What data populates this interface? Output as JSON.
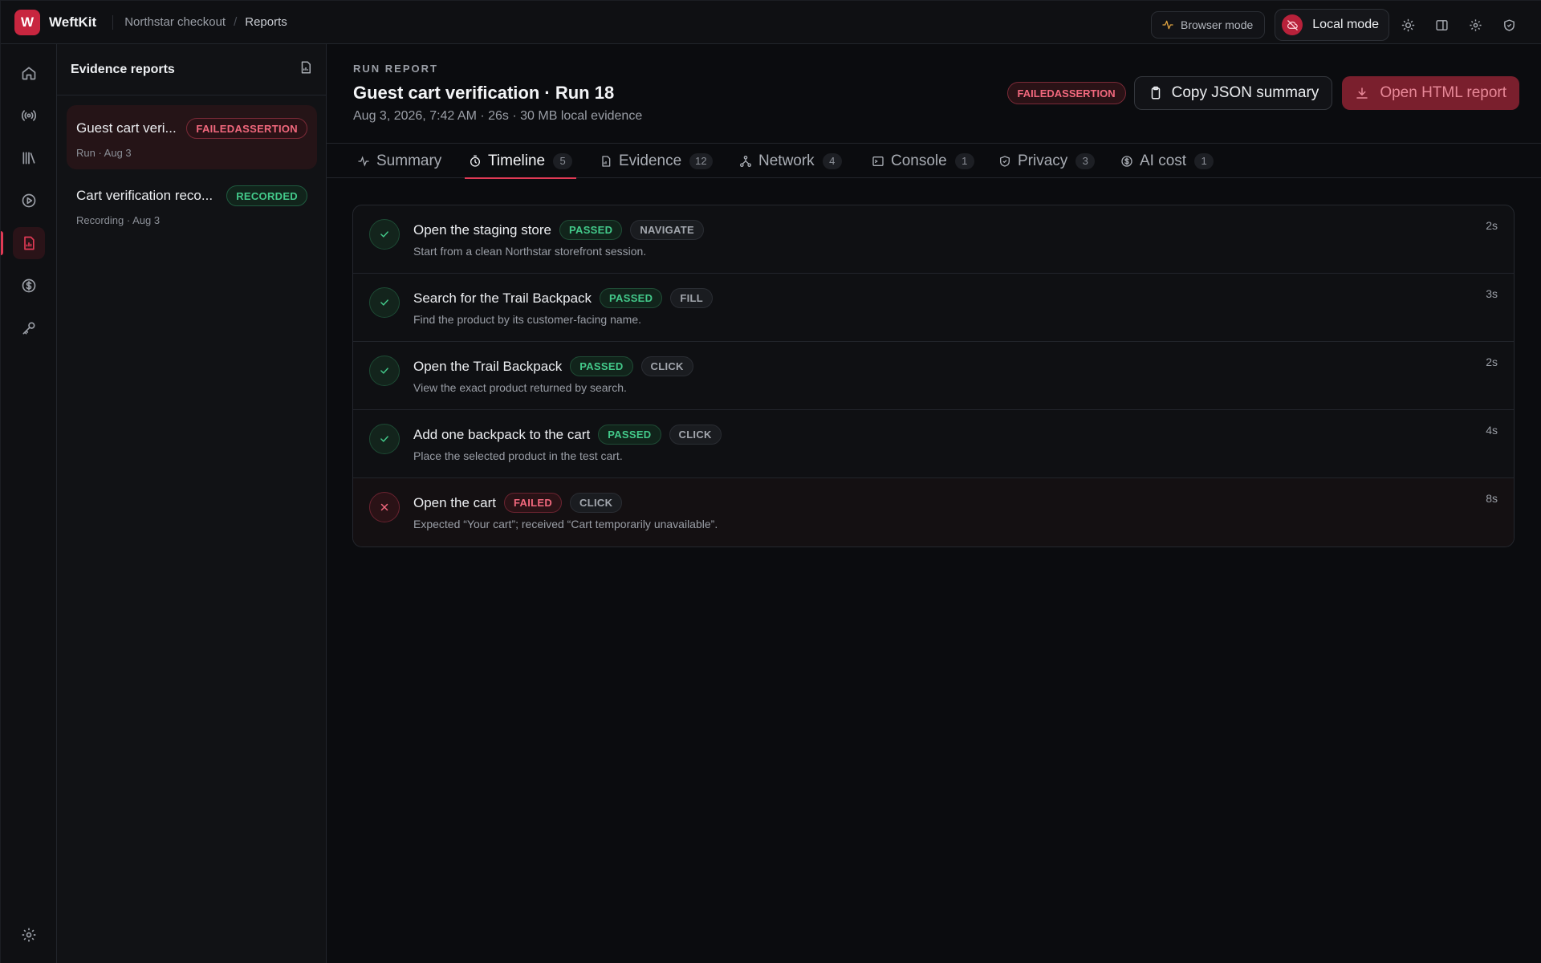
{
  "app": {
    "logo_letter": "W",
    "name": "WeftKit"
  },
  "breadcrumb": {
    "project": "Northstar checkout",
    "separator": "/",
    "current": "Reports"
  },
  "topbar": {
    "browser_mode_label": "Browser mode",
    "local_mode_label": "Local mode",
    "icons": [
      "sun-icon",
      "panel-icon",
      "gear-icon",
      "shield-icon"
    ]
  },
  "rail": {
    "items": [
      "home-icon",
      "broadcast-icon",
      "library-icon",
      "play-icon",
      "report-icon",
      "dollar-icon",
      "key-icon"
    ],
    "active": "report-icon",
    "bottom": "gear-icon"
  },
  "panel": {
    "title": "Evidence reports",
    "reports": [
      {
        "title": "Guest cart veri...",
        "badge": "FAILEDASSERTION",
        "subtitle": "Run · Aug 3",
        "active": true
      },
      {
        "title": "Cart verification reco...",
        "badge": "RECORDED",
        "subtitle": "Recording · Aug 3",
        "active": false
      }
    ]
  },
  "report": {
    "kicker": "RUN REPORT",
    "title": "Guest cart verification · Run 18",
    "meta": "Aug 3, 2026, 7:42 AM · 26s · 30 MB local evidence",
    "status_badge": "FAILEDASSERTION",
    "copy_button": "Copy JSON summary",
    "open_button": "Open HTML report"
  },
  "tabs": [
    {
      "label": "Summary",
      "count": "",
      "icon": "activity-icon"
    },
    {
      "label": "Timeline",
      "count": "5",
      "icon": "timer-icon",
      "active": true
    },
    {
      "label": "Evidence",
      "count": "12",
      "icon": "file-icon"
    },
    {
      "label": "Network",
      "count": "4",
      "icon": "network-icon"
    },
    {
      "label": "Console",
      "count": "1",
      "icon": "console-icon"
    },
    {
      "label": "Privacy",
      "count": "3",
      "icon": "shield-icon"
    },
    {
      "label": "AI cost",
      "count": "1",
      "icon": "dollar-icon"
    }
  ],
  "steps": [
    {
      "title": "Open the staging store",
      "status": "PASSED",
      "action": "NAVIGATE",
      "desc": "Start from a clean Northstar storefront session.",
      "duration": "2s"
    },
    {
      "title": "Search for the Trail Backpack",
      "status": "PASSED",
      "action": "FILL",
      "desc": "Find the product by its customer-facing name.",
      "duration": "3s"
    },
    {
      "title": "Open the Trail Backpack",
      "status": "PASSED",
      "action": "CLICK",
      "desc": "View the exact product returned by search.",
      "duration": "2s"
    },
    {
      "title": "Add one backpack to the cart",
      "status": "PASSED",
      "action": "CLICK",
      "desc": "Place the selected product in the test cart.",
      "duration": "4s"
    },
    {
      "title": "Open the cart",
      "status": "FAILED",
      "action": "CLICK",
      "desc": "Expected “Your cart”; received “Cart temporarily unavailable”.",
      "duration": "8s"
    }
  ],
  "colors": {
    "accent": "#e03a55",
    "pass": "#43c98a",
    "fail": "#f1687d"
  }
}
